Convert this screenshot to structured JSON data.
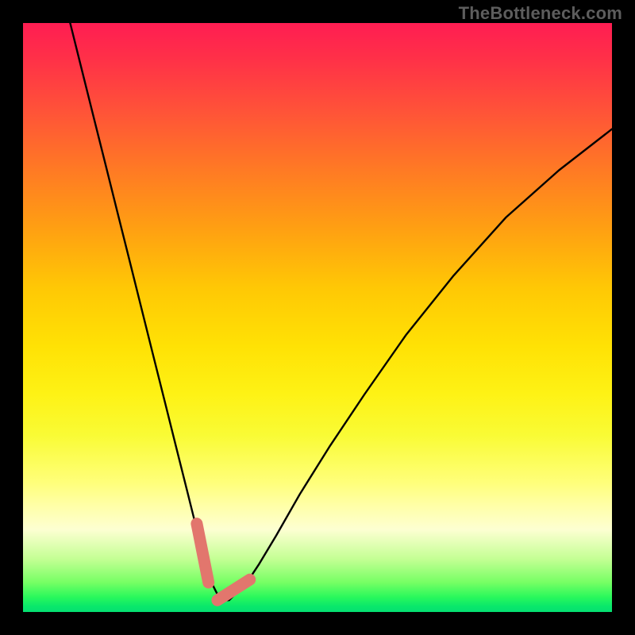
{
  "watermark": "TheBottleneck.com",
  "chart_data": {
    "type": "line",
    "title": "",
    "xlabel": "",
    "ylabel": "",
    "xlim": [
      0,
      100
    ],
    "ylim": [
      0,
      100
    ],
    "series": [
      {
        "name": "bottleneck-curve",
        "x": [
          8,
          10,
          12,
          14,
          16,
          18,
          20,
          22,
          24,
          26,
          28,
          30,
          31,
          32,
          33,
          34,
          35,
          36,
          38,
          40,
          43,
          47,
          52,
          58,
          65,
          73,
          82,
          91,
          100
        ],
        "values": [
          100,
          92,
          84,
          76,
          68,
          60,
          52,
          44,
          36,
          28,
          20,
          12,
          8,
          5,
          3,
          2,
          2,
          3,
          5,
          8,
          13,
          20,
          28,
          37,
          47,
          57,
          67,
          75,
          82
        ]
      }
    ],
    "highlight_segments": [
      {
        "name": "left-near-min",
        "x": [
          29.5,
          31.5
        ],
        "values": [
          15,
          5
        ]
      },
      {
        "name": "right-near-min",
        "x": [
          33,
          38.5
        ],
        "values": [
          2,
          5.5
        ]
      }
    ],
    "colors": {
      "curve": "#000000",
      "highlight": "#e2766d",
      "background_top": "#ff1d52",
      "background_bottom": "#05df72",
      "frame": "#000000"
    }
  }
}
